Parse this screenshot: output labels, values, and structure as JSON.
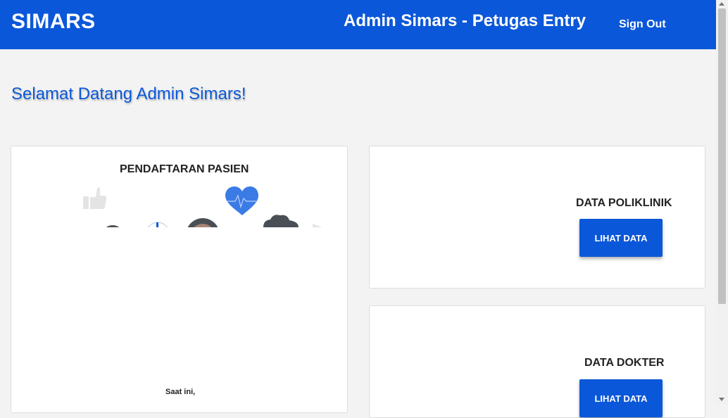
{
  "navbar": {
    "brand": "SIMARS",
    "title": "Admin Simars - Petugas Entry",
    "signout_label": "Sign Out",
    "background": "#0b57d9"
  },
  "welcome": "Selamat Datang Admin Simars!",
  "cards": {
    "pasien": {
      "title": "PENDAFTARAN PASIEN",
      "caption": "Saat ini,"
    },
    "poliklinik": {
      "title": "DATA POLIKLINIK",
      "button_label": "LIHAT DATA"
    },
    "dokter": {
      "title": "DATA DOKTER",
      "button_label": "LIHAT DATA"
    }
  },
  "icons": {
    "illustration": [
      "thumbs-up-icon",
      "heart-pulse-icon",
      "facebook-icon",
      "avatar-icon",
      "cloud-icon"
    ]
  }
}
